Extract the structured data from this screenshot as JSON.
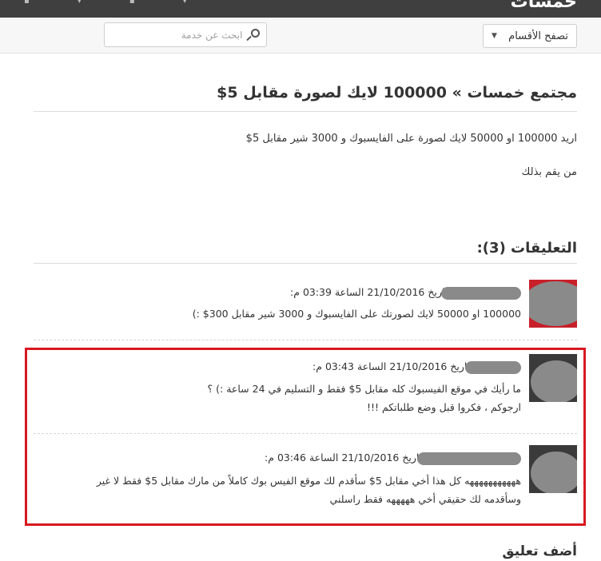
{
  "topbar": {
    "logo": "خمسات"
  },
  "searchbar": {
    "browse_label": "تصفح الأقسام",
    "search_placeholder": "ابحث عن خدمة"
  },
  "post": {
    "title": "مجتمع خمسات » 100000 لايك لصورة مقابل 5$",
    "body_line_1": "اريد 100000 او 50000 لايك لصورة على الفايسبوك و 3000 شير مقابل 5$",
    "body_line_2": "من يقم بذلك"
  },
  "comments": {
    "heading": "التعليقات (3):",
    "items": [
      {
        "meta": "بتاريخ 21/10/2016 الساعة 03:39 م:",
        "text_1": "100000 او 50000 لايك لصورتك على الفايسبوك و 3000 شير مقابل 300$ :)"
      },
      {
        "meta": "بتاريخ 21/10/2016 الساعة 03:43 م:",
        "text_1": "ما رأيك في موقع الفيسبوك كله مقابل 5$ فقط و التسليم في 24 ساعة :) ؟",
        "text_2": "ارجوكم ، فكروا قبل وضع طلباتكم !!!"
      },
      {
        "meta": "بتاريخ 21/10/2016 الساعة 03:46 م:",
        "text_1": "هههههههههههه كل هذا أخي مقابل 5$ سأقدم لك موقع الفيس بوك كاملاً من مارك مقابل 5$ فقط لا غير",
        "text_2": "وسأقدمه لك حقيقي أخي هههههه فقط راسلني"
      }
    ]
  },
  "add_comment_heading": "أضف تعليق",
  "colors": {
    "topbar": "#3f3f3f",
    "highlight_border": "#d71920",
    "avatar_red": "#c8202a",
    "redaction": "#8a8a8a"
  }
}
